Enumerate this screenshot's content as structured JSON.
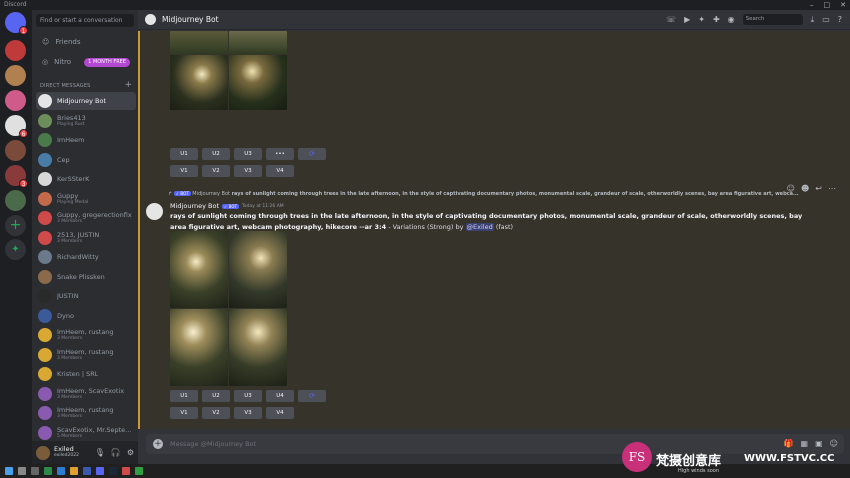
{
  "window": {
    "title": "Discord"
  },
  "sidebar": {
    "search_placeholder": "Find or start a conversation",
    "friends_label": "Friends",
    "nitro_label": "Nitro",
    "nitro_badge": "1 MONTH FREE",
    "dm_header": "DIRECT MESSAGES",
    "dms": [
      {
        "name": "Midjourney Bot",
        "sub": "",
        "color": "#e5e5e5"
      },
      {
        "name": "Bries413",
        "sub": "Playing Rust",
        "color": "#6b8e5a"
      },
      {
        "name": "ImHeem",
        "sub": "",
        "color": "#4a7a4a"
      },
      {
        "name": "Cep",
        "sub": "",
        "color": "#4a7ca8"
      },
      {
        "name": "KerSSterK",
        "sub": "",
        "color": "#d8d8d8"
      },
      {
        "name": "Guppy",
        "sub": "Playing Medal",
        "color": "#c4694a"
      },
      {
        "name": "Guppy, gregerectionfix",
        "sub": "3 Members",
        "color": "#d04a4a"
      },
      {
        "name": "2513, JUSTIN",
        "sub": "3 Members",
        "color": "#d04a4a"
      },
      {
        "name": "RichardWitty",
        "sub": "",
        "color": "#6a7a8a"
      },
      {
        "name": "Snake Plissken",
        "sub": "",
        "color": "#8a6a4a"
      },
      {
        "name": "JUSTIN",
        "sub": "",
        "color": "#2a2a2a"
      },
      {
        "name": "Dyno",
        "sub": "",
        "color": "#3a5a9a"
      },
      {
        "name": "ImHeem, rustang",
        "sub": "3 Members",
        "color": "#d8a832"
      },
      {
        "name": "ImHeem, rustang",
        "sub": "3 Members",
        "color": "#d8a832"
      },
      {
        "name": "Kristen | SRL",
        "sub": "",
        "color": "#d8a832"
      },
      {
        "name": "ImHeem, ScavExotix",
        "sub": "3 Members",
        "color": "#8a5ab0"
      },
      {
        "name": "ImHeem, rustang",
        "sub": "3 Members",
        "color": "#8a5ab0"
      },
      {
        "name": "ScavExotix, Mr.Septe...",
        "sub": "5 Members",
        "color": "#8a5ab0"
      }
    ]
  },
  "servers": [
    {
      "badge": "1",
      "color": "#5865f2"
    },
    {
      "badge": "",
      "color": "#c03a3a"
    },
    {
      "badge": "",
      "color": "#b08050"
    },
    {
      "badge": "",
      "color": "#d05a8a"
    },
    {
      "badge": "6",
      "color": "#e0e0e0"
    },
    {
      "badge": "",
      "color": "#7a4a3a"
    },
    {
      "badge": "3",
      "color": "#8a3a3a"
    },
    {
      "badge": "",
      "color": "#4a6a4a"
    }
  ],
  "user": {
    "name": "Exiled",
    "tag": "exiled2022"
  },
  "header": {
    "title": "Midjourney Bot",
    "search_placeholder": "Search"
  },
  "top_grid": {
    "buttons_u": [
      "U1",
      "U2",
      "U3",
      "•••",
      "⟳"
    ],
    "buttons_v": [
      "V1",
      "V2",
      "V3",
      "V4"
    ]
  },
  "message": {
    "reply_author": "Midjourney Bot",
    "reply_badge": "✓ BOT",
    "reply_text": "rays of sunlight coming through trees in the late afternoon, in the style of captivating documentary photos, monumental scale, grandeur of scale, otherworldly scenes, bay area figurative art, webca...",
    "author": "Midjourney Bot",
    "badge": "✓ BOT",
    "time": "Today at 11:26 AM",
    "prompt": "rays of sunlight coming through trees in the late afternoon, in the style of captivating documentary photos, monumental scale, grandeur of scale, otherworldly scenes, bay area figurative art, webcam photography, hikecore --ar 3:4",
    "suffix": " - Variations (Strong) by ",
    "mention": "@Exiled",
    "speed": " (fast)",
    "buttons_u": [
      "U1",
      "U2",
      "U3",
      "U4",
      "⟳"
    ],
    "buttons_v": [
      "V1",
      "V2",
      "V3",
      "V4"
    ]
  },
  "composer": {
    "placeholder": "Message @Midjourney Bot"
  },
  "taskbar": {
    "weather": "High winds soon"
  },
  "watermark": {
    "logo": "FS",
    "cn": "梵摄创意库",
    "url": "WWW.FSTVC.CC"
  }
}
